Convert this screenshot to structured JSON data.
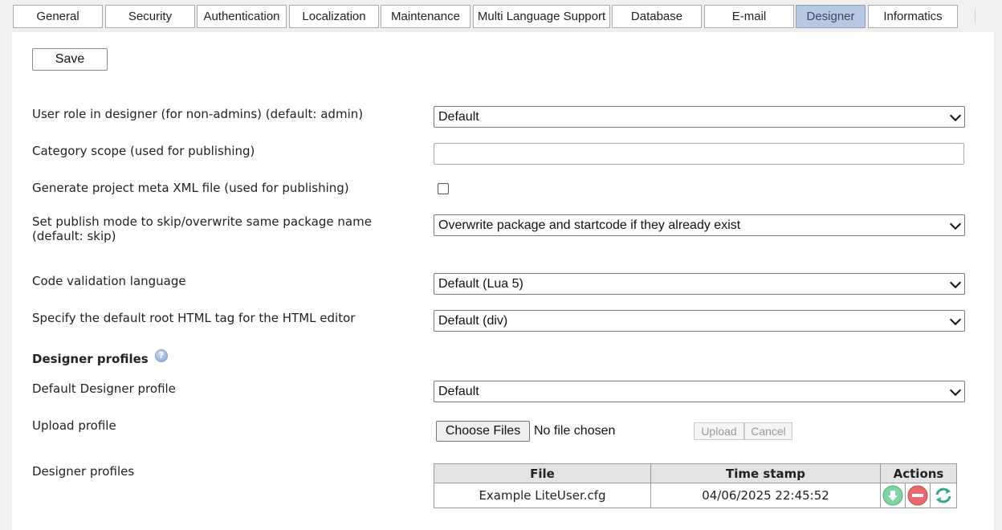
{
  "tabs": [
    {
      "label": "General"
    },
    {
      "label": "Security"
    },
    {
      "label": "Authentication"
    },
    {
      "label": "Localization"
    },
    {
      "label": "Maintenance"
    },
    {
      "label": "Multi Language Support"
    },
    {
      "label": "Database"
    },
    {
      "label": "E-mail"
    },
    {
      "label": "Designer",
      "active": true
    },
    {
      "label": "Informatics"
    }
  ],
  "toolbar": {
    "save_label": "Save"
  },
  "settings": {
    "user_role": {
      "label": "User role in designer (for non-admins) (default: admin)",
      "value": "Default"
    },
    "category_scope": {
      "label": "Category scope (used for publishing)",
      "value": ""
    },
    "meta_xml": {
      "label": "Generate project meta XML file (used for publishing)",
      "checked": false
    },
    "publish_mode": {
      "label_line1": "Set publish mode to skip/overwrite same package name",
      "label_line2": "(default: skip)",
      "value": "Overwrite package and startcode if they already exist"
    },
    "code_validation": {
      "label": "Code validation language",
      "value": "Default (Lua 5)"
    },
    "root_tag": {
      "label": "Specify the default root HTML tag for the HTML editor",
      "value": "Default (div)"
    }
  },
  "profiles_section": {
    "heading": "Designer profiles",
    "help_icon": "question-circle-icon",
    "default_profile": {
      "label": "Default Designer profile",
      "value": "Default"
    },
    "upload": {
      "label": "Upload profile",
      "choose_label": "Choose Files",
      "status": "No file chosen",
      "upload_label": "Upload",
      "cancel_label": "Cancel"
    },
    "table": {
      "label": "Designer profiles",
      "headers": {
        "file": "File",
        "timestamp": "Time stamp",
        "actions": "Actions"
      },
      "rows": [
        {
          "file": "Example LiteUser.cfg",
          "timestamp": "04/06/2025 22:45:52"
        }
      ],
      "action_icons": [
        "download-icon",
        "delete-icon",
        "refresh-icon"
      ],
      "colors": {
        "download": "#6cc58f",
        "delete": "#e05a5a",
        "refresh": "#3aa38a"
      }
    }
  }
}
